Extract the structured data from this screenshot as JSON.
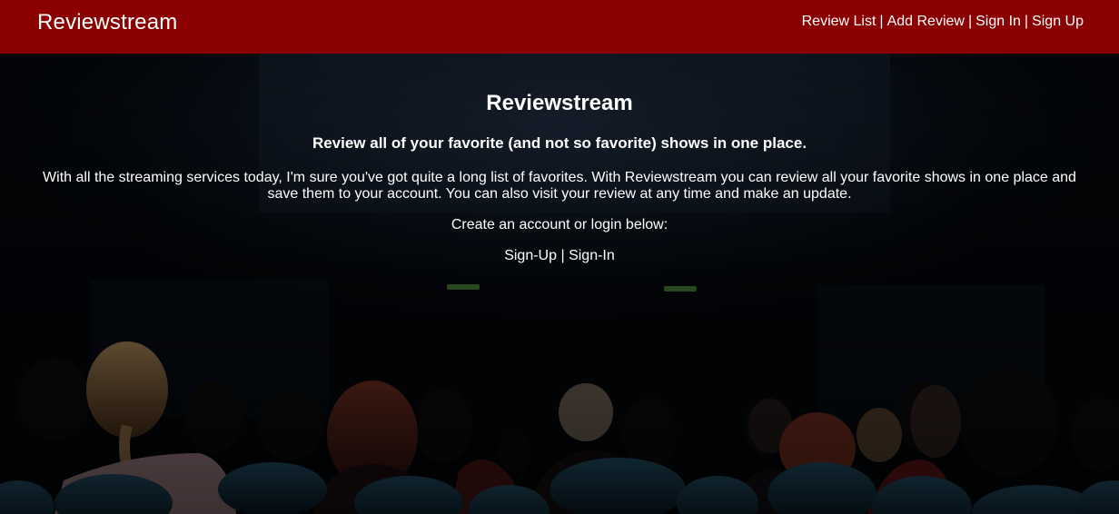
{
  "header": {
    "brand": "Reviewstream",
    "nav": {
      "review_list": "Review List",
      "add_review": "Add Review",
      "sign_in": "Sign In",
      "sign_up": "Sign Up",
      "separator": "|"
    },
    "background_color": "#8b0000"
  },
  "hero": {
    "title": "Reviewstream",
    "subtitle": "Review all of your favorite (and not so favorite) shows in one place.",
    "description": "With all the streaming services today, I'm sure you've got quite a long list of favorites. With Reviewstream you can review all your favorite shows in one place and save them to your account. You can also visit your review at any time and make an update.",
    "cta": "Create an account or login below:",
    "links": {
      "sign_up": "Sign-Up",
      "separator": "|",
      "sign_in": "Sign-In"
    }
  }
}
